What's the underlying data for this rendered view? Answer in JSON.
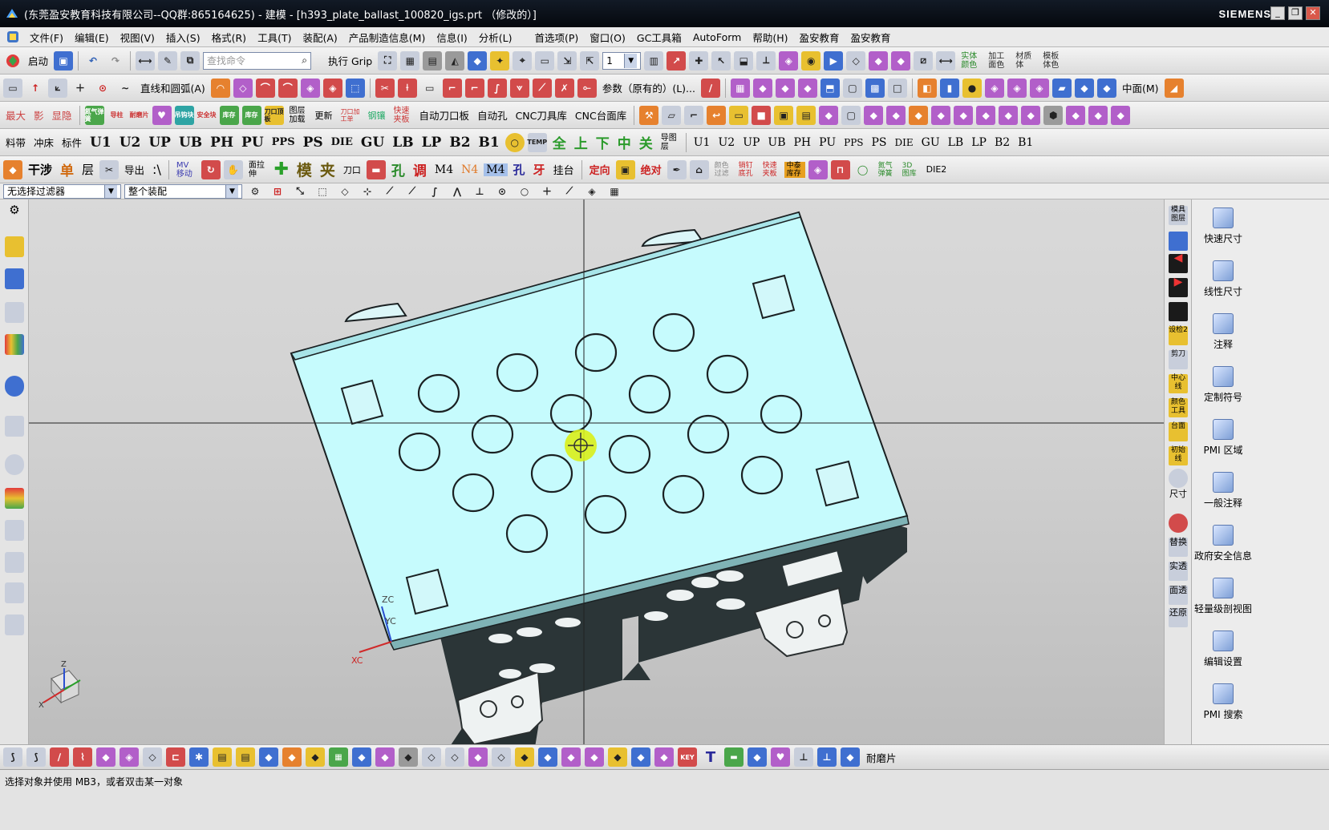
{
  "window": {
    "title": "(东莞盈安教育科技有限公司--QQ群:865164625) - 建模 - [h393_plate_ballast_100820_igs.prt （修改的）]",
    "brand": "SIEMENS",
    "minimize": "_",
    "restore": "❐",
    "close": "✕"
  },
  "menu": {
    "items": [
      "文件(F)",
      "编辑(E)",
      "视图(V)",
      "插入(S)",
      "格式(R)",
      "工具(T)",
      "装配(A)",
      "产品制造信息(M)",
      "信息(I)",
      "分析(L)"
    ],
    "items2": [
      "首选项(P)",
      "窗口(O)",
      "GC工具箱",
      "AutoForm",
      "帮助(H)",
      "盈安教育",
      "盈安教育"
    ]
  },
  "toolbar1": {
    "start": "启动",
    "search_placeholder": "查找命令",
    "grip": "执行 Grip",
    "layer_value": "1",
    "labels_right": [
      "实体颜色",
      "加工面色",
      "材质体",
      "模板体色"
    ]
  },
  "toolbar2": {
    "curve_label": "直线和圆弧(A)",
    "param_label": "参数（原有的）(L)...",
    "view_label": "中面(M)"
  },
  "toolbar3": {
    "small": [
      "最大",
      "影",
      "显隐"
    ],
    "labels": [
      "氮气弹簧",
      "导柱",
      "耐磨片",
      "",
      "吊钩块",
      "安全块",
      "库存",
      "库存",
      "刀口顶板"
    ],
    "text": [
      "图层加载",
      "更新",
      "刀口加工单",
      "钢镶",
      "快速夹板"
    ],
    "auto_text": [
      "自动刀口板",
      "自动孔",
      "CNC刀具库",
      "CNC台面库"
    ]
  },
  "toolbar4": {
    "left": [
      "料带",
      "冲床",
      "标件"
    ],
    "codes": [
      "U1",
      "U2",
      "UP",
      "UB",
      "PH",
      "PU",
      "PPS",
      "PS",
      "DIE",
      "GU",
      "LB",
      "LP",
      "B2",
      "B1"
    ],
    "chinese": [
      "全",
      "上",
      "下",
      "中",
      "关"
    ],
    "guide": "导图层",
    "codes2": [
      "U1",
      "U2",
      "UP",
      "UB",
      "PH",
      "PU",
      "PPS",
      "PS",
      "DIE",
      "GU",
      "LB",
      "LP",
      "B2",
      "B1"
    ]
  },
  "toolbar5": {
    "items": [
      "干涉",
      "单",
      "层",
      "导出",
      "MV移动",
      "面拉伸",
      "模",
      "夹",
      "刀口",
      "孔",
      "调",
      "M4",
      "N4",
      "M4",
      "孔",
      "牙",
      "挂台",
      "定向",
      "绝对",
      "颜色过滤",
      "销钉底孔",
      "快速夹板",
      "中泰库存",
      "氮气弹簧",
      "3D图库",
      "DIE2"
    ]
  },
  "selectionbar": {
    "filter": "无选择过滤器",
    "scope": "整个装配"
  },
  "viewport": {
    "bg": "#d6d6d6",
    "plate_color": "#c6fbfd",
    "dark_color": "#2a3436",
    "axis_zc": "ZC",
    "axis_yc": "YC",
    "axis_xc": "XC",
    "triad_z": "Z",
    "triad_x": "X"
  },
  "right_strip": {
    "items": [
      "模具图层",
      "",
      "",
      "",
      "",
      "",
      "设检2",
      "剪刀",
      "中心线",
      "颜色工具",
      "台面",
      "初始线",
      "",
      "尺寸",
      "",
      "替换",
      "实透",
      "面透",
      "还原"
    ]
  },
  "right_panel": {
    "items": [
      {
        "label": "快速尺寸"
      },
      {
        "label": "线性尺寸"
      },
      {
        "label": "注释"
      },
      {
        "label": "定制符号"
      },
      {
        "label": "PMI 区域"
      },
      {
        "label": "一般注释"
      },
      {
        "label": "政府安全信息"
      },
      {
        "label": "轻量级剖视图"
      },
      {
        "label": "编辑设置"
      },
      {
        "label": "PMI 搜索"
      }
    ]
  },
  "bottom_toolbar": {
    "label": "耐磨片"
  },
  "status": {
    "text": "选择对象并使用 MB3，或者双击某一对象"
  }
}
